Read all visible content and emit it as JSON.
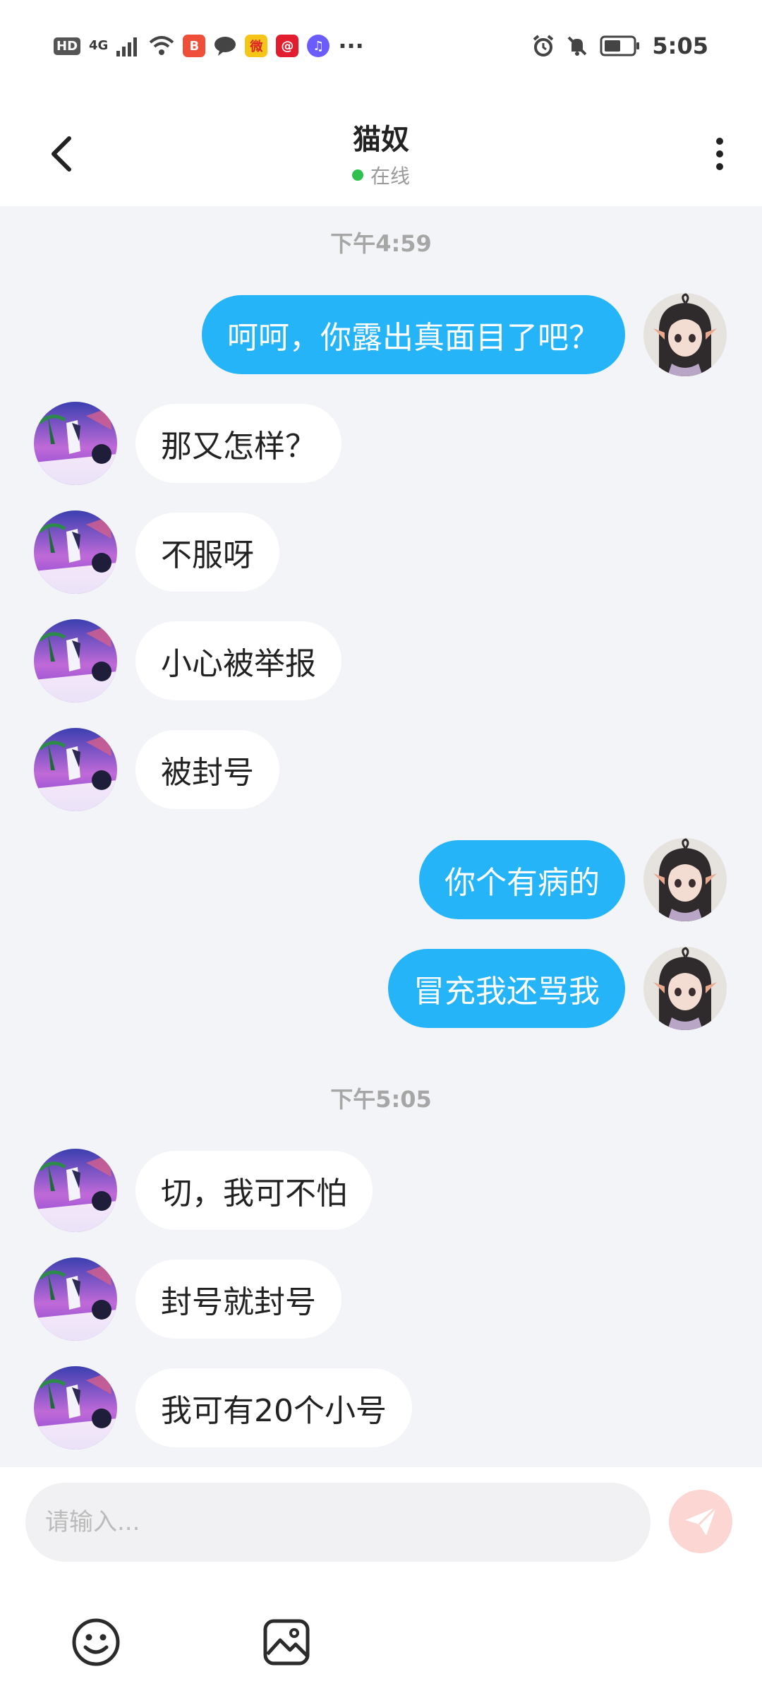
{
  "status_bar": {
    "time": "5:05",
    "network_label": "4G",
    "hd_label": "HD",
    "overflow_label": "···"
  },
  "header": {
    "title": "猫奴",
    "status": "在线",
    "status_color": "#2ec04f"
  },
  "timestamps": [
    "下午4:59",
    "下午5:05"
  ],
  "messages": [
    {
      "side": "out",
      "text": "呵呵，你露出真面目了吧？"
    },
    {
      "side": "in",
      "text": "那又怎样？"
    },
    {
      "side": "in",
      "text": "不服呀"
    },
    {
      "side": "in",
      "text": "小心被举报"
    },
    {
      "side": "in",
      "text": "被封号"
    },
    {
      "side": "out",
      "text": "你个有病的"
    },
    {
      "side": "out",
      "text": "冒充我还骂我"
    },
    {
      "side": "in",
      "text": "切，我可不怕"
    },
    {
      "side": "in",
      "text": "封号就封号"
    },
    {
      "side": "in",
      "text": "我可有20个小号"
    }
  ],
  "input": {
    "placeholder": "请输入...",
    "value": ""
  },
  "toolbar": {
    "emoji_icon": "emoji-icon",
    "image_icon": "image-icon"
  },
  "colors": {
    "outgoing_bubble": "#24b4f7",
    "incoming_bubble": "#ffffff",
    "chat_background": "#f3f4f7",
    "send_button": "#fbd6d3"
  }
}
